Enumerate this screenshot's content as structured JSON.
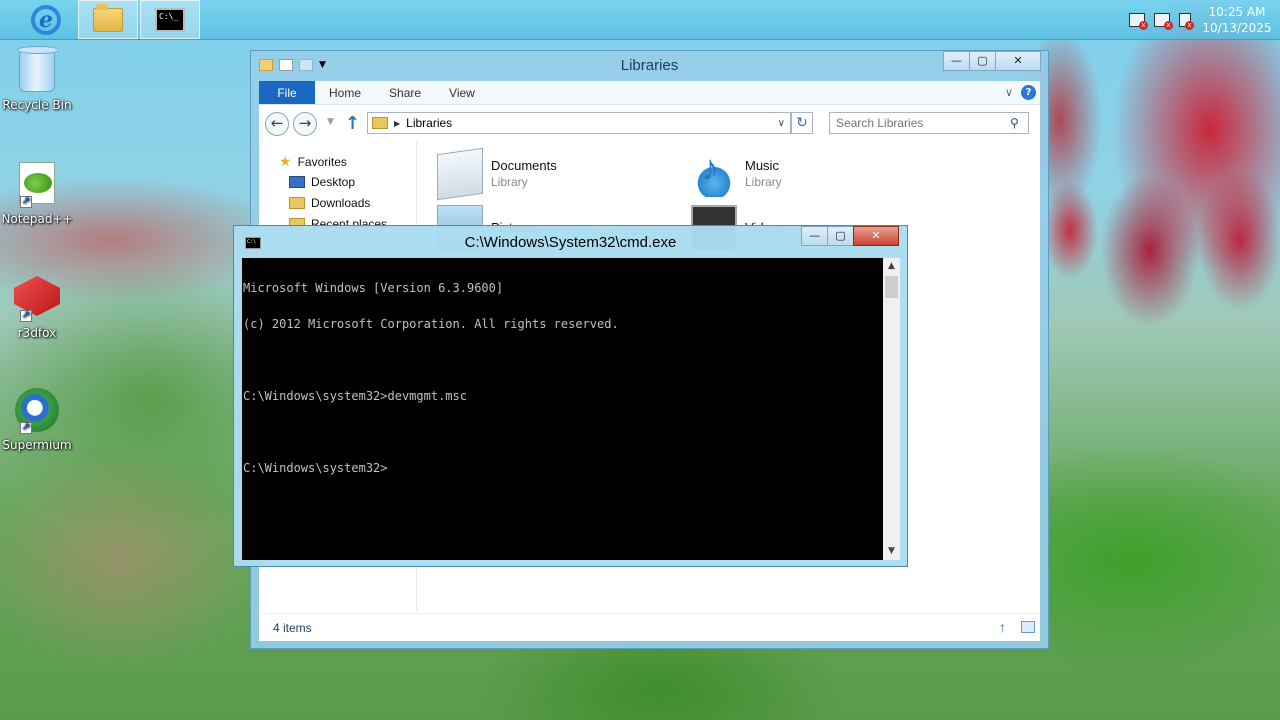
{
  "taskbar": {
    "buttons": [
      {
        "name": "internet-explorer",
        "icon": "ie-icon"
      },
      {
        "name": "file-explorer",
        "icon": "folder-icon"
      },
      {
        "name": "command-prompt",
        "icon": "cmd-icon"
      }
    ],
    "tray_icons": [
      "flag-error-icon",
      "network-error-icon",
      "volume-muted-icon"
    ],
    "clock": {
      "time": "10:25 AM",
      "date": "10/13/2025"
    }
  },
  "desktop_icons": [
    {
      "label": "Recycle Bin",
      "icon": "recycle-bin-icon"
    },
    {
      "label": "Notepad++",
      "icon": "notepadpp-icon"
    },
    {
      "label": "r3dfox",
      "icon": "r3dfox-icon"
    },
    {
      "label": "Supermium",
      "icon": "supermium-icon"
    }
  ],
  "explorer": {
    "title": "Libraries",
    "ribbon_tabs": [
      "File",
      "Home",
      "Share",
      "View"
    ],
    "address": "Libraries",
    "search_placeholder": "Search Libraries",
    "nav": {
      "favorites": "Favorites",
      "items": [
        "Desktop",
        "Downloads",
        "Recent places"
      ]
    },
    "libraries": [
      {
        "name": "Documents",
        "type": "Library"
      },
      {
        "name": "Music",
        "type": "Library"
      },
      {
        "name": "Pictures",
        "type": ""
      },
      {
        "name": "Videos",
        "type": ""
      }
    ],
    "status": "4 items"
  },
  "cmd": {
    "title": "C:\\Windows\\System32\\cmd.exe",
    "lines": [
      "Microsoft Windows [Version 6.3.9600]",
      "(c) 2012 Microsoft Corporation. All rights reserved.",
      "",
      "C:\\Windows\\system32>devmgmt.msc",
      "",
      "C:\\Windows\\system32>"
    ]
  },
  "window_buttons": {
    "minimize": "—",
    "maximize": "▢",
    "close": "✕"
  }
}
